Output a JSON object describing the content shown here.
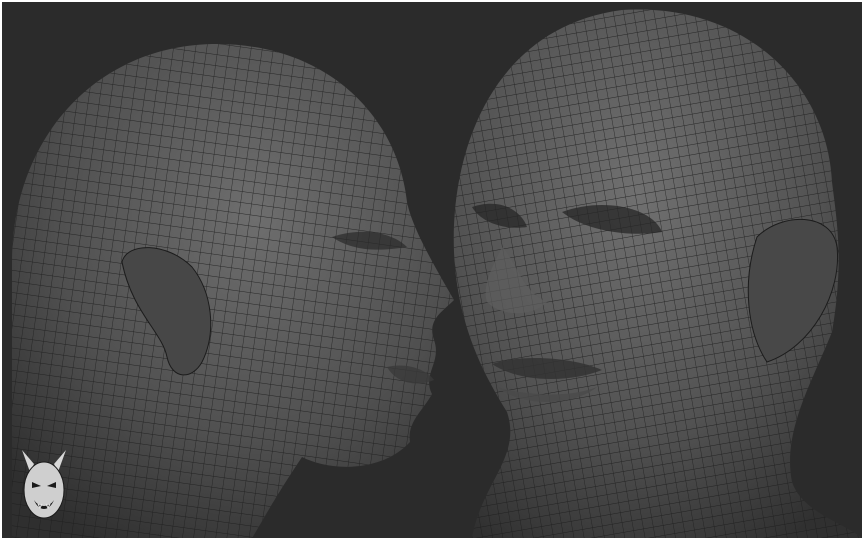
{
  "scene": {
    "background_color": "#2b2b2b",
    "frame_color": "#ffffff",
    "mesh_color": "#5a5a5a",
    "wire_color": "#1c1c1c",
    "subjects": [
      "profile-head-left",
      "frontal-head-right"
    ],
    "logo_icon": "oni-mask-icon"
  }
}
